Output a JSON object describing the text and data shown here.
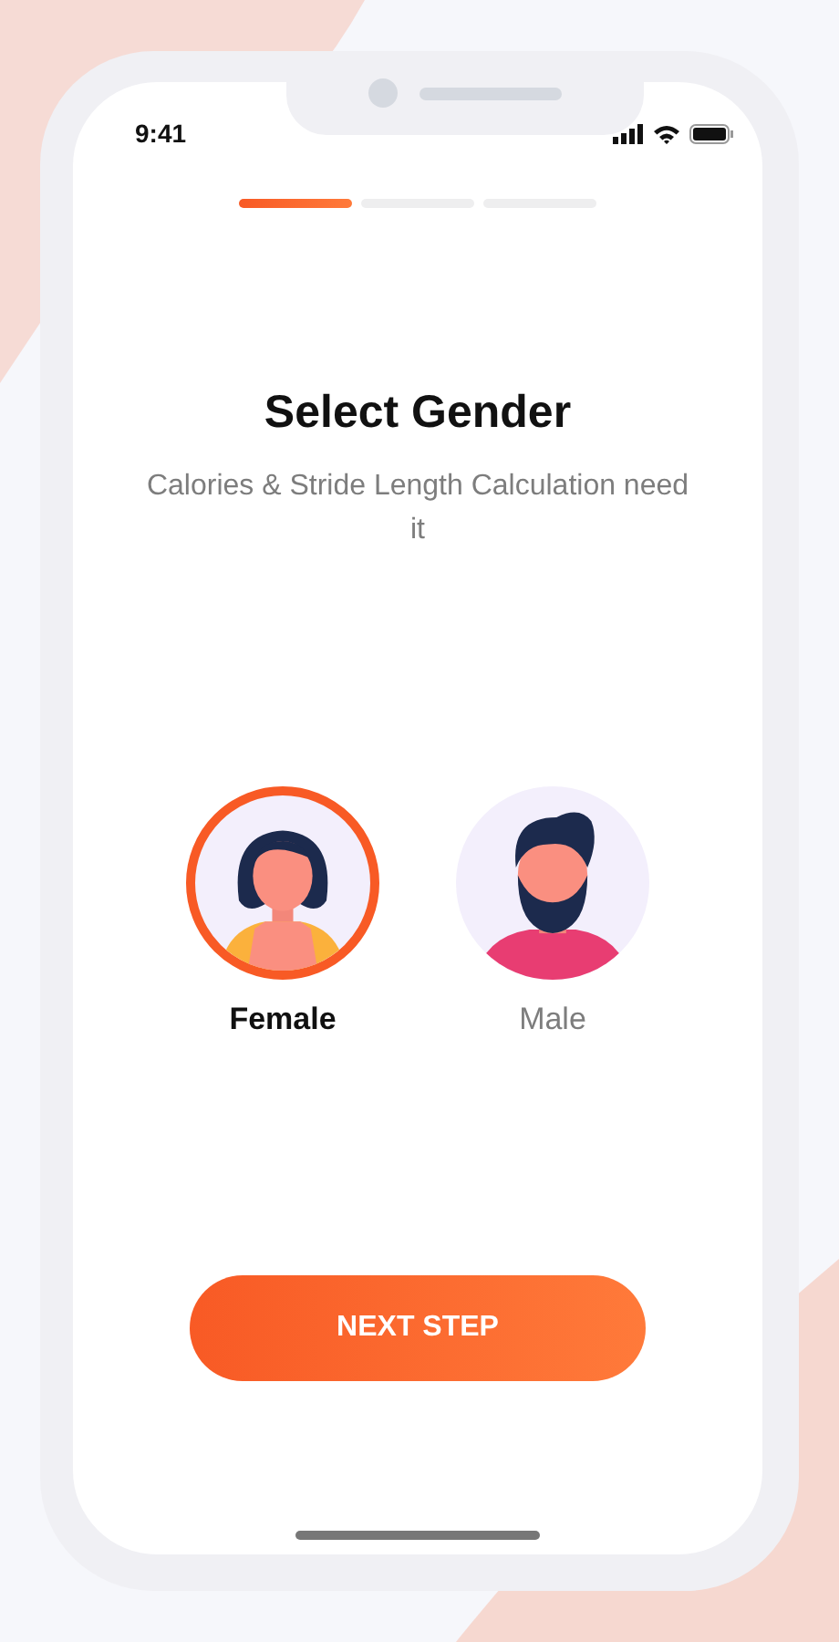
{
  "status_bar": {
    "time": "9:41"
  },
  "steps": [
    {
      "done": true
    },
    {
      "done": false
    },
    {
      "done": false
    }
  ],
  "title": "Select Gender",
  "subtitle": "Calories & Stride Length Calculation need it",
  "genders": [
    {
      "kind": "female",
      "label": "Female",
      "selected": true
    },
    {
      "kind": "male",
      "label": "Male",
      "selected": false
    }
  ],
  "button": "NEXT STEP"
}
